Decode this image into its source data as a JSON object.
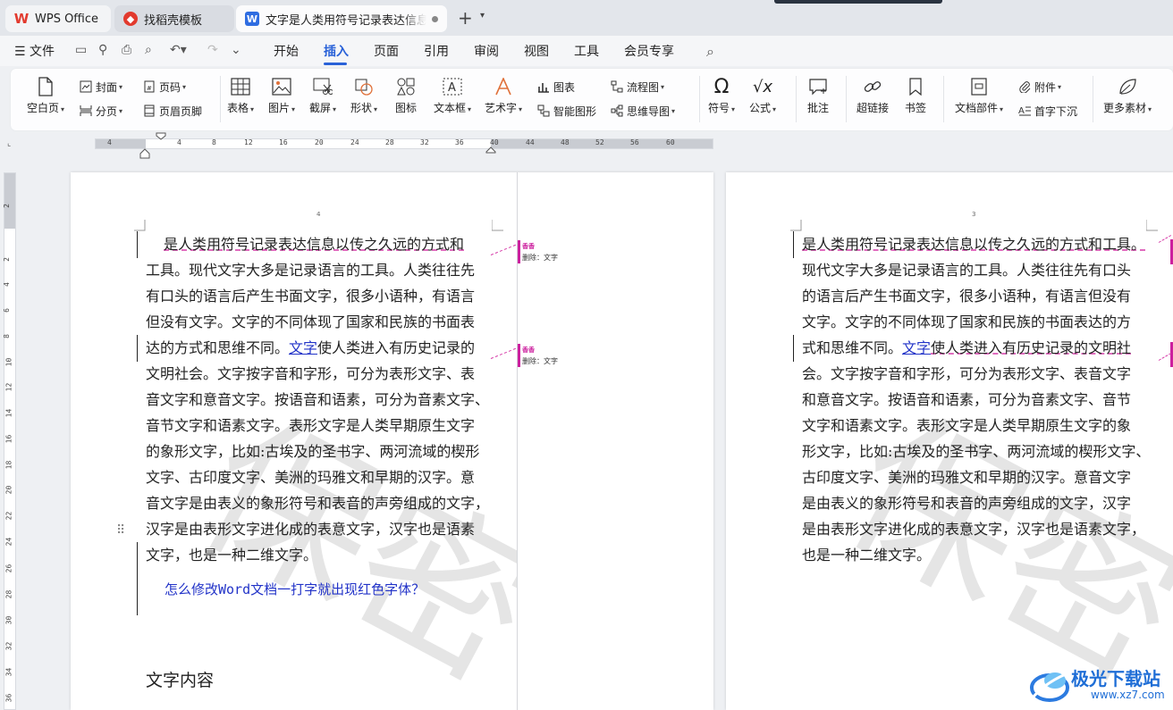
{
  "tabs": [
    {
      "label": "WPS Office",
      "icon": "wps-logo-icon"
    },
    {
      "label": "找稻壳模板",
      "icon": "docer-icon"
    },
    {
      "label": "文字是人类用符号记录表达信息以传之久远的方式和工具",
      "icon": "word-doc-icon"
    }
  ],
  "menu": {
    "file": "文件",
    "items": [
      "开始",
      "插入",
      "页面",
      "引用",
      "审阅",
      "视图",
      "工具",
      "会员专享"
    ],
    "active": "插入"
  },
  "ribbon": {
    "blank_page": "空白页",
    "cover": "封面",
    "page_break": "分页",
    "page_number": "页码",
    "header_footer": "页眉页脚",
    "table": "表格",
    "picture": "图片",
    "screenshot": "截屏",
    "shape": "形状",
    "icon": "图标",
    "textbox": "文本框",
    "wordart": "艺术字",
    "chart": "图表",
    "smart_shape": "智能图形",
    "flowchart": "流程图",
    "mindmap": "思维导图",
    "symbol": "符号",
    "formula": "公式",
    "comment": "批注",
    "hyperlink": "超链接",
    "bookmark": "书签",
    "doc_parts": "文档部件",
    "attachment": "附件",
    "drop_cap": "首字下沉",
    "more": "更多素材"
  },
  "ruler": {
    "h_ticks": [
      "4",
      "4",
      "8",
      "12",
      "16",
      "20",
      "24",
      "28",
      "32",
      "36",
      "40",
      "44",
      "48",
      "52",
      "56",
      "60"
    ],
    "v_ticks": [
      "2",
      "2",
      "4",
      "6",
      "8",
      "10",
      "12",
      "14",
      "16",
      "18",
      "20",
      "22",
      "24",
      "26",
      "28",
      "30",
      "32",
      "34",
      "36"
    ]
  },
  "left_page": {
    "page_number": "4",
    "watermark": "保密",
    "lines": [
      [
        "",
        "是人类用符号记录表达信息以传之久远的方式和"
      ],
      [
        "",
        "工具。现代文字大多是记录语言的工具。人类往往先"
      ],
      [
        "",
        "有口头的语言后产生书面文字，很多小语种，有语言"
      ],
      [
        "",
        "但没有文字。文字的不同体现了国家和民族的书面表"
      ],
      [
        "达的方式和思维不同。",
        "文字使人类进入有历史记录的"
      ],
      [
        "",
        "文明社会。文字按字音和字形，可分为表形文字、表"
      ],
      [
        "",
        "音文字和意音文字。按语音和语素，可分为音素文字、"
      ],
      [
        "",
        "音节文字和语素文字。表形文字是人类早期原生文字"
      ],
      [
        "",
        "的象形文字，比如:古埃及的圣书字、两河流域的楔形"
      ],
      [
        "",
        "文字、古印度文字、美洲的玛雅文和早期的汉字。意"
      ],
      [
        "",
        "音文字是由表义的象形符号和表音的声旁组成的文字，"
      ],
      [
        "",
        "汉字是由表形文字进化成的表意文字，汉字也是语素"
      ],
      [
        "",
        "文字，也是一种二维文字。"
      ]
    ],
    "inserted_word": "文字",
    "question": "怎么修改Word文档一打字就出现红色字体？",
    "section_title": "文字内容",
    "markups": [
      {
        "author": "香香",
        "text": "删除：文字"
      },
      {
        "author": "香香",
        "text": "删除：文字"
      }
    ]
  },
  "right_page": {
    "page_number": "3",
    "watermark": "保密",
    "lines": [
      "是人类用符号记录表达信息以传之久远的方式和工具。",
      "现代文字大多是记录语言的工具。人类往往先有口头",
      "的语言后产生书面文字，很多小语种，有语言但没有",
      "文字。文字的不同体现了国家和民族的书面表达的方",
      "式和思维不同。文字使人类进入有历史记录的文明社",
      "会。文字按字音和字形，可分为表形文字、表音文字",
      "和意音文字。按语音和语素，可分为音素文字、音节",
      "文字和语素文字。表形文字是人类早期原生文字的象",
      "形文字，比如:古埃及的圣书字、两河流域的楔形文字、",
      "古印度文字、美洲的玛雅文和早期的汉字。意音文字",
      "是由表义的象形符号和表音的声旁组成的文字，汉字",
      "是由表形文字进化成的表意文字，汉字也是语素文字，",
      "也是一种二维文字。"
    ]
  },
  "logo": {
    "name": "极光下载站",
    "url": "www.xz7.com"
  },
  "colors": {
    "accent": "#2a62d8",
    "revision": "#cc1f9e",
    "inserted": "#2233c8"
  }
}
